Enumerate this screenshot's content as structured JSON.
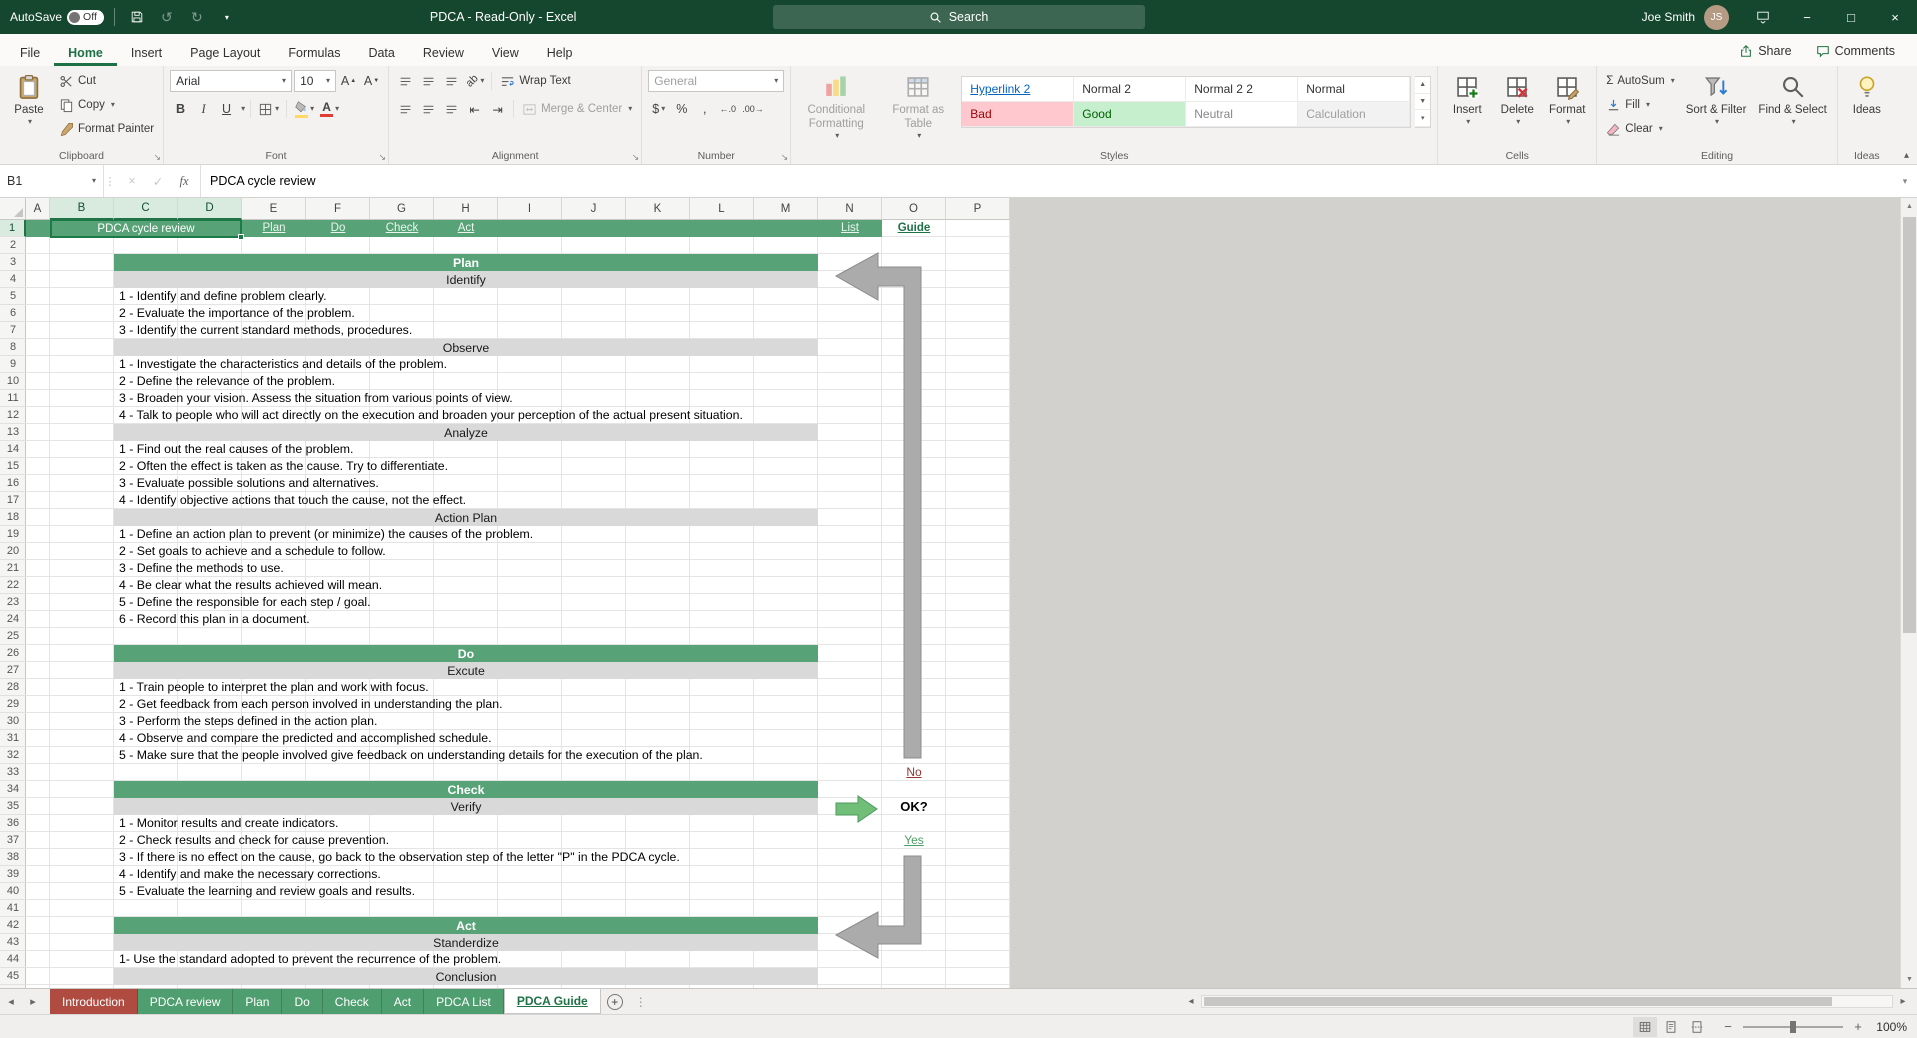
{
  "colors": {
    "titlebar_green": "#15472E",
    "accent_green": "#217346",
    "band_green": "#57A377",
    "band_gray": "#D9D9D9",
    "sheet_tab_green": "#4F9E6F",
    "sheet_tab_red": "#B04B42",
    "hyperlink_blue": "#0563C1",
    "bad_red": "#9C0006",
    "bad_bg": "#FFC7CE",
    "good_green": "#006100",
    "good_bg": "#C6EFCE"
  },
  "titlebar": {
    "autosave_label": "AutoSave",
    "autosave_state": "Off",
    "title": "PDCA  -  Read-Only  -  Excel",
    "search_placeholder": "Search",
    "user_name": "Joe Smith"
  },
  "ribbon_tabs": {
    "tabs": [
      "File",
      "Home",
      "Insert",
      "Page Layout",
      "Formulas",
      "Data",
      "Review",
      "View",
      "Help"
    ],
    "active": "Home",
    "share": "Share",
    "comments": "Comments"
  },
  "ribbon": {
    "clipboard": {
      "label": "Clipboard",
      "paste": "Paste",
      "cut": "Cut",
      "copy": "Copy",
      "format_painter": "Format Painter"
    },
    "font": {
      "label": "Font",
      "name": "Arial",
      "size": "10"
    },
    "alignment": {
      "label": "Alignment",
      "wrap_text": "Wrap Text",
      "merge_center": "Merge & Center"
    },
    "number": {
      "label": "Number",
      "format": "General"
    },
    "styles": {
      "label": "Styles",
      "conditional": "Conditional Formatting",
      "format_table": "Format as Table",
      "gallery": [
        "Hyperlink 2",
        "Normal 2",
        "Normal 2 2",
        "Normal",
        "Bad",
        "Good",
        "Neutral",
        "Calculation"
      ]
    },
    "cells": {
      "label": "Cells",
      "insert": "Insert",
      "delete": "Delete",
      "format": "Format"
    },
    "editing": {
      "label": "Editing",
      "autosum": "AutoSum",
      "fill": "Fill",
      "clear": "Clear",
      "sort_filter": "Sort & Filter",
      "find_select": "Find & Select"
    },
    "ideas": {
      "label": "Ideas",
      "button": "Ideas"
    }
  },
  "icons": {
    "bold": "B",
    "italic": "I",
    "underline": "U",
    "autosum": "Σ",
    "dollar": "$",
    "percent": "%",
    "comma": ",",
    "inc_decimal": "←.0",
    "dec_decimal": ".00→",
    "orientation": "ab"
  },
  "formula_bar": {
    "name_box": "B1",
    "fx": "fx",
    "formula": "PDCA cycle review"
  },
  "grid": {
    "columns": [
      "A",
      "B",
      "C",
      "D",
      "E",
      "F",
      "G",
      "H",
      "I",
      "J",
      "K",
      "L",
      "M",
      "N",
      "O",
      "P"
    ],
    "row_count": 45,
    "selection": {
      "cell": "B1",
      "text": "PDCA cycle review",
      "col_start": "B",
      "col_end": "D",
      "row": 1
    }
  },
  "nav_row": {
    "links": [
      {
        "label": "Plan",
        "col": "E"
      },
      {
        "label": "Do",
        "col": "F"
      },
      {
        "label": "Check",
        "col": "G"
      },
      {
        "label": "Act",
        "col": "H"
      },
      {
        "label": "List",
        "col": "N"
      },
      {
        "label": "Guide",
        "col": "O",
        "active": true
      }
    ]
  },
  "content": {
    "sections": [
      {
        "title": "Plan",
        "row": 3,
        "subs": [
          {
            "title": "Identify",
            "row": 4,
            "items": [
              "1 - Identify and define problem clearly.",
              "2 - Evaluate the importance of the problem.",
              "3 - Identify the current standard methods, procedures."
            ]
          },
          {
            "title": "Observe",
            "row": 8,
            "items": [
              "1 - Investigate the characteristics and details of the problem.",
              "2 - Define the relevance of the problem.",
              "3 - Broaden your vision. Assess the situation from various points of view.",
              "4 - Talk to people who will act directly on the execution and broaden your perception of the actual present situation."
            ]
          },
          {
            "title": "Analyze",
            "row": 13,
            "items": [
              "1 - Find out the real causes of the problem.",
              "2 - Often the effect is taken as the cause. Try to differentiate.",
              "3 - Evaluate possible solutions and alternatives.",
              "4 - Identify objective actions that touch the cause, not the effect."
            ]
          },
          {
            "title": "Action Plan",
            "row": 18,
            "items": [
              "1 - Define an action plan to prevent (or minimize) the causes of the problem.",
              "2 - Set goals to achieve and a schedule to follow.",
              "3 - Define the methods to use.",
              "4 - Be clear what the results achieved will mean.",
              "5 - Define the responsible for each step / goal.",
              "6 - Record this plan in a document."
            ]
          }
        ]
      },
      {
        "title": "Do",
        "row": 26,
        "subs": [
          {
            "title": "Excute",
            "row": 27,
            "items": [
              "1 - Train people to interpret the plan and work with focus.",
              "2 - Get feedback from each person involved in understanding the plan.",
              "3 - Perform the steps defined in the action plan.",
              "4 - Observe and compare the predicted and accomplished schedule.",
              "5 - Make sure that the people involved give feedback on understanding details for the execution of the plan."
            ]
          }
        ]
      },
      {
        "title": "Check",
        "row": 34,
        "subs": [
          {
            "title": "Verify",
            "row": 35,
            "items": [
              "1 - Monitor results and create indicators.",
              "2 - Check results and check for cause prevention.",
              "3 - If there is no effect on the cause, go back to the observation step of the letter \"P\" in the PDCA cycle.",
              "4 - Identify and make the necessary corrections.",
              "5 - Evaluate the learning and review goals and results."
            ]
          }
        ]
      },
      {
        "title": "Act",
        "row": 42,
        "subs": [
          {
            "title": "Standerdize",
            "row": 43,
            "items": [
              "1- Use the standard adopted to prevent the recurrence of the problem."
            ]
          },
          {
            "title": "Conclusion",
            "row": 45,
            "items": []
          }
        ]
      }
    ]
  },
  "flow": {
    "no": {
      "label": "No",
      "row": 33
    },
    "ok": {
      "label": "OK?",
      "row": 35
    },
    "yes": {
      "label": "Yes",
      "row": 37
    }
  },
  "sheet_tabs": {
    "tabs": [
      {
        "label": "Introduction",
        "color": "red"
      },
      {
        "label": "PDCA review",
        "color": "green"
      },
      {
        "label": "Plan",
        "color": "green"
      },
      {
        "label": "Do",
        "color": "green"
      },
      {
        "label": "Check",
        "color": "green"
      },
      {
        "label": "Act",
        "color": "green"
      },
      {
        "label": "PDCA List",
        "color": "green"
      },
      {
        "label": "PDCA Guide",
        "active": true
      }
    ]
  },
  "status_bar": {
    "zoom": "100%"
  }
}
